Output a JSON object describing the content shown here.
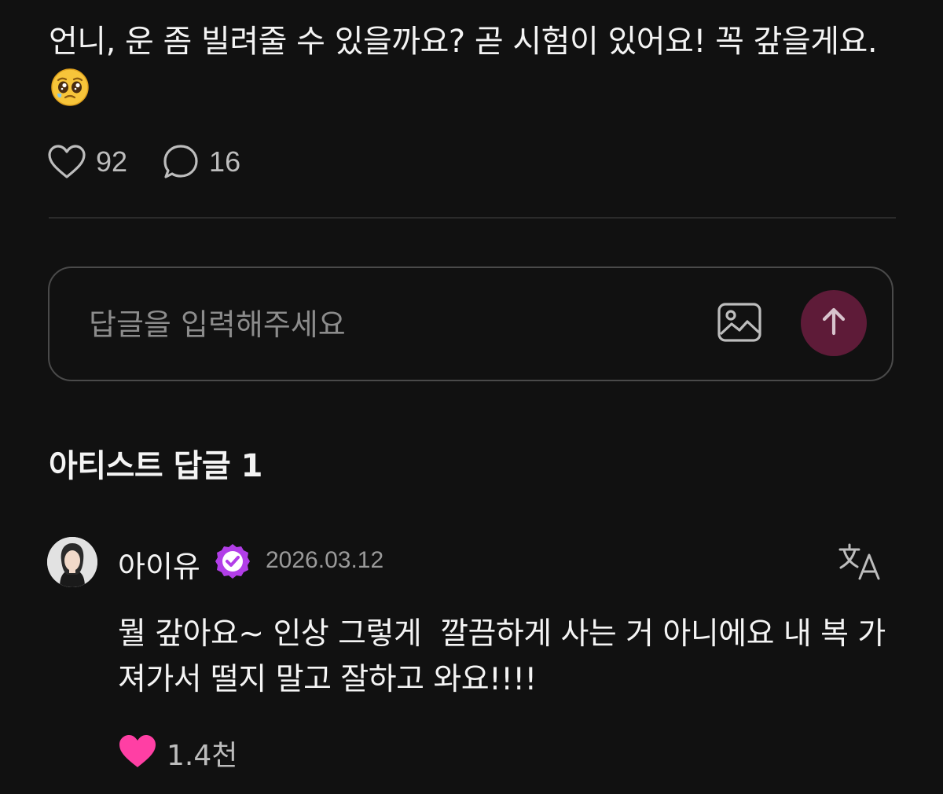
{
  "post": {
    "text": "언니, 운 좀 빌려줄 수 있을까요? 곧 시험이 있어요! 꼭 갚을게요.",
    "emoji_icon": "pleading-face-emoji",
    "likes": "92",
    "comments": "16"
  },
  "reply_box": {
    "placeholder": "답글을 입력해주세요",
    "image_icon": "image-icon",
    "send_icon": "arrow-up-icon",
    "send_color": "#5e1b38"
  },
  "artist_replies": {
    "title": "아티스트 답글 1",
    "items": [
      {
        "author": "아이유",
        "verified_icon": "verified-badge-icon",
        "verified_color": "#b23ee8",
        "date": "2026.03.12",
        "translate_icon": "translate-icon",
        "text": "뭘 갚아요~ 인상 그렇게  깔끔하게 사는 거 아니에요 내 복 가져가서 떨지 말고 잘하고 와요!!!!",
        "likes": "1.4천",
        "like_color": "#ff3fa4"
      }
    ]
  }
}
